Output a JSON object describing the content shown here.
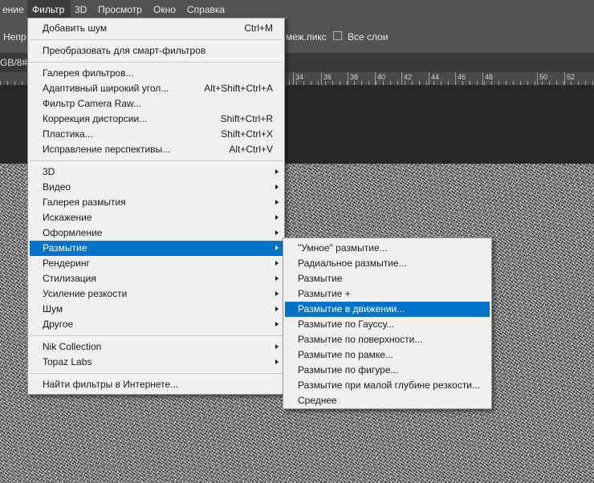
{
  "menubar": {
    "items": [
      "ение",
      "Фильтр",
      "3D",
      "Просмотр",
      "Окно",
      "Справка"
    ],
    "active": "Фильтр"
  },
  "options_bar": {
    "left_text": "Непр",
    "sample_text": "меж.пикс",
    "all_layers_label": "Все слои"
  },
  "doc_tab": {
    "text": "GB/8#"
  },
  "ruler": {
    "ticks": [
      "34",
      "36",
      "38",
      "40",
      "42",
      "44",
      "46",
      "48",
      "50",
      "52"
    ]
  },
  "filter_menu": {
    "last_filter": {
      "label": "Добавить шум",
      "shortcut": "Ctrl+M"
    },
    "convert_smart": "Преобразовать для смарт-фильтров",
    "group1": [
      {
        "label": "Галерея фильтров...",
        "shortcut": ""
      },
      {
        "label": "Адаптивный широкий угол...",
        "shortcut": "Alt+Shift+Ctrl+A"
      },
      {
        "label": "Фильтр Camera Raw...",
        "shortcut": "Shift+Ctrl+A"
      },
      {
        "label": "Коррекция дисторсии...",
        "shortcut": "Shift+Ctrl+R"
      },
      {
        "label": "Пластика...",
        "shortcut": "Shift+Ctrl+X"
      },
      {
        "label": "Исправление перспективы...",
        "shortcut": "Alt+Ctrl+V"
      }
    ],
    "submenus": [
      "3D",
      "Видео",
      "Галерея размытия",
      "Искажение",
      "Оформление",
      "Размытие",
      "Рендеринг",
      "Стилизация",
      "Усиление резкости",
      "Шум",
      "Другое"
    ],
    "active_submenu": "Размытие",
    "plugins": [
      "Nik Collection",
      "Topaz Labs"
    ],
    "browse_online": "Найти фильтры в Интернете..."
  },
  "blur_submenu": {
    "items": [
      "\"Умное\" размытие...",
      "Радиальное размытие...",
      "Размытие",
      "Размытие +",
      "Размытие в движении...",
      "Размытие по Гауссу...",
      "Размытие по поверхности...",
      "Размытие по рамке...",
      "Размытие по фигуре...",
      "Размытие при малой глубине резкости...",
      "Среднее"
    ],
    "highlighted": "Размытие в движении..."
  },
  "colors": {
    "menu_bg": "#f0f0f0",
    "highlight": "#0073c6",
    "chrome": "#535353"
  }
}
